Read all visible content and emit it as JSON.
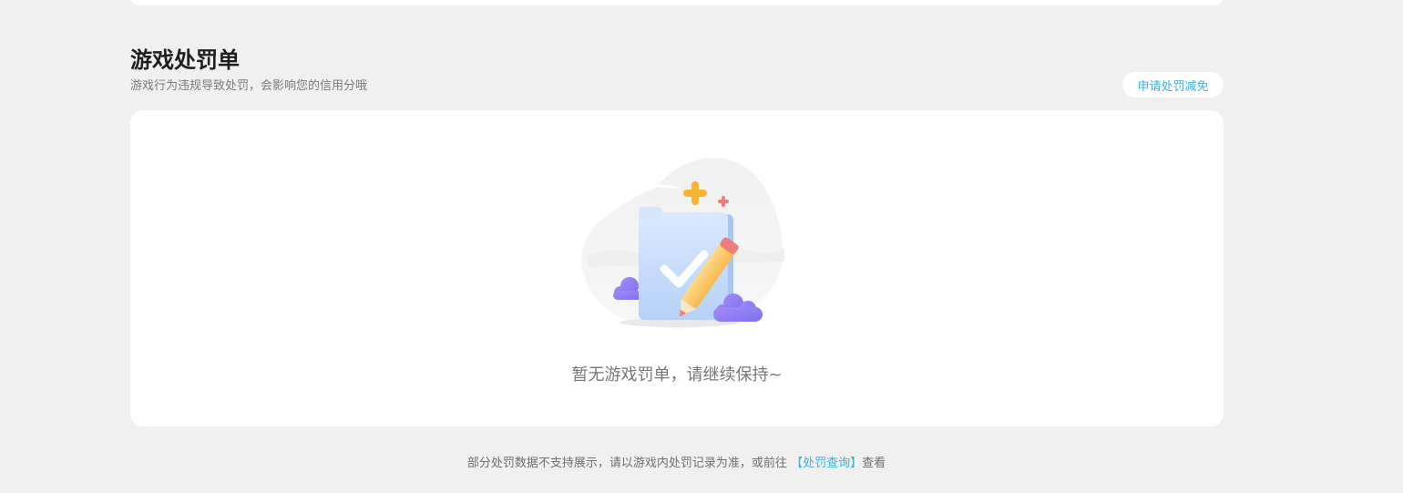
{
  "penalty": {
    "title": "游戏处罚单",
    "subtitle": "游戏行为违规导致处罚，会影响您的信用分哦",
    "appeal_button": "申请处罚减免",
    "empty_message": "暂无游戏罚单，请继续保持~",
    "illustration_icon": "empty-checklist-icon"
  },
  "footer": {
    "note_before": "部分处罚数据不支持展示，请以游戏内处罚记录为准，或前往",
    "link_label": "【处罚查询】",
    "note_after": "查看"
  },
  "colors": {
    "background": "#f0f0f0",
    "card": "#ffffff",
    "accent": "#3db1d8",
    "cloud": "#8f7cf6",
    "pencil": "#fbc96b",
    "sparkle": "#f8b431"
  }
}
